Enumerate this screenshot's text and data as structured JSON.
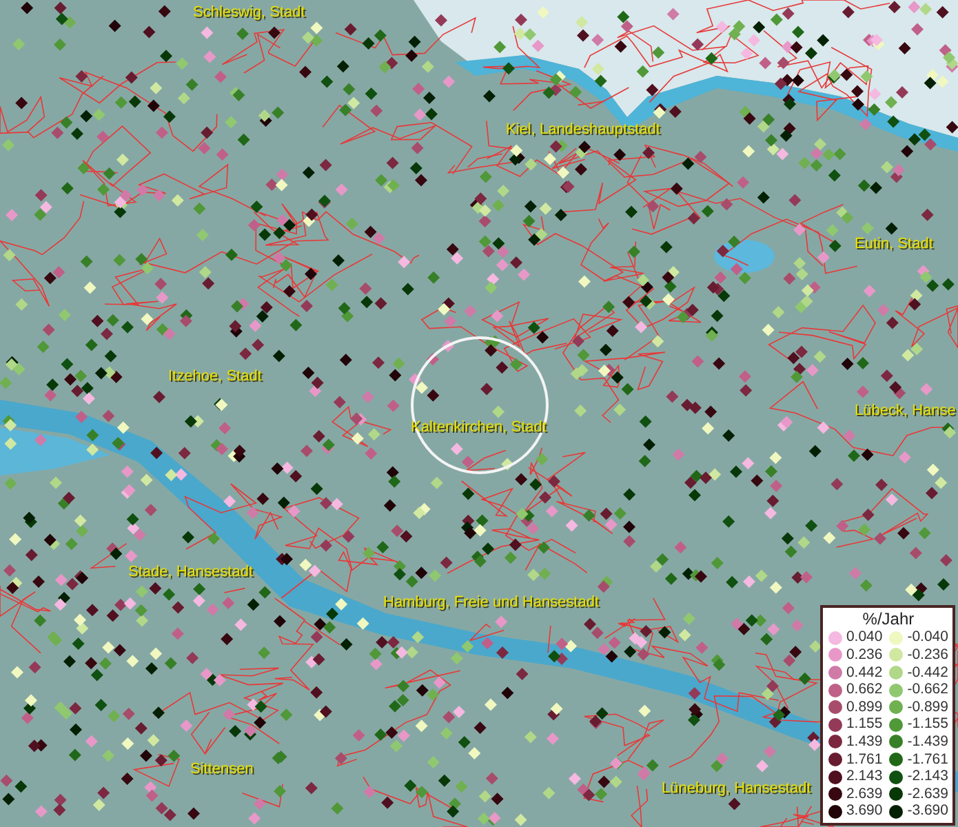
{
  "map": {
    "labels": [
      {
        "text": "Schleswig, Stadt"
      },
      {
        "text": "Kiel, Landeshauptstadt"
      },
      {
        "text": "Eutin, Stadt"
      },
      {
        "text": "Itzehoe, Stadt"
      },
      {
        "text": "Lübeck, Hanse"
      },
      {
        "text": "Kaltenkirchen, Stadt"
      },
      {
        "text": "Stade, Hansestadt"
      },
      {
        "text": "Hamburg, Freie und Hansestadt"
      },
      {
        "text": "Sittensen"
      },
      {
        "text": "Lüneburg, Hansestadt"
      }
    ]
  },
  "legend": {
    "title": "%/Jahr",
    "entries": [
      {
        "value": "0.040",
        "color": "#f5b8e0"
      },
      {
        "value": "-0.040",
        "color": "#f0f8c0"
      },
      {
        "value": "0.236",
        "color": "#e898c8"
      },
      {
        "value": "-0.236",
        "color": "#d0e8a0"
      },
      {
        "value": "0.442",
        "color": "#d07aa8"
      },
      {
        "value": "-0.442",
        "color": "#b0d888"
      },
      {
        "value": "0.662",
        "color": "#c06088"
      },
      {
        "value": "-0.662",
        "color": "#90c870"
      },
      {
        "value": "0.899",
        "color": "#a84c6c"
      },
      {
        "value": "-0.899",
        "color": "#70b050"
      },
      {
        "value": "1.155",
        "color": "#943a58"
      },
      {
        "value": "-1.155",
        "color": "#509838"
      },
      {
        "value": "1.439",
        "color": "#7c2840"
      },
      {
        "value": "-1.439",
        "color": "#388028"
      },
      {
        "value": "1.761",
        "color": "#681c30"
      },
      {
        "value": "-1.761",
        "color": "#206818"
      },
      {
        "value": "2.143",
        "color": "#501020"
      },
      {
        "value": "-2.143",
        "color": "#105010"
      },
      {
        "value": "2.639",
        "color": "#380810"
      },
      {
        "value": "-2.639",
        "color": "#083808"
      },
      {
        "value": "3.690",
        "color": "#200408"
      },
      {
        "value": "-3.690",
        "color": "#042004"
      }
    ]
  }
}
